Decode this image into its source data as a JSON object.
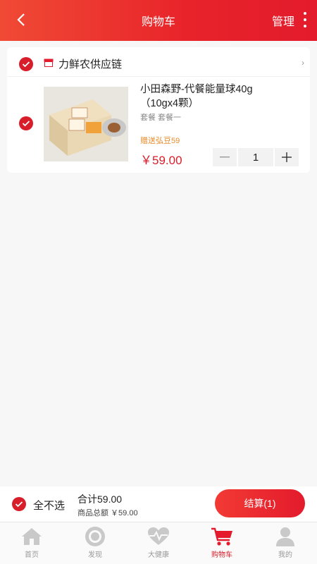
{
  "header": {
    "title": "购物车",
    "manage_label": "管理"
  },
  "cart": {
    "shop": {
      "name": "力鲜农供应链"
    },
    "items": [
      {
        "name": "小田森野-代餐能量球40g（10gx4颗）",
        "spec": "套餐 套餐一",
        "promo": "赠送弘豆59",
        "price": "￥59.00",
        "quantity": "1"
      }
    ]
  },
  "footer": {
    "select_all_label": "全不选",
    "total_label": "合计59.00",
    "subtotal_label": "商品总额 ￥59.00",
    "checkout_label": "结算(1)"
  },
  "tabbar": {
    "tabs": [
      {
        "label": "首页",
        "icon": "home-icon"
      },
      {
        "label": "发现",
        "icon": "discover-icon"
      },
      {
        "label": "大健康",
        "icon": "health-icon"
      },
      {
        "label": "购物车",
        "icon": "cart-icon",
        "active": true
      },
      {
        "label": "我的",
        "icon": "profile-icon"
      }
    ]
  },
  "colors": {
    "brand_red": "#e31b2c",
    "promo_orange": "#e98a2a",
    "inactive_icon": "#c9c9c9"
  }
}
